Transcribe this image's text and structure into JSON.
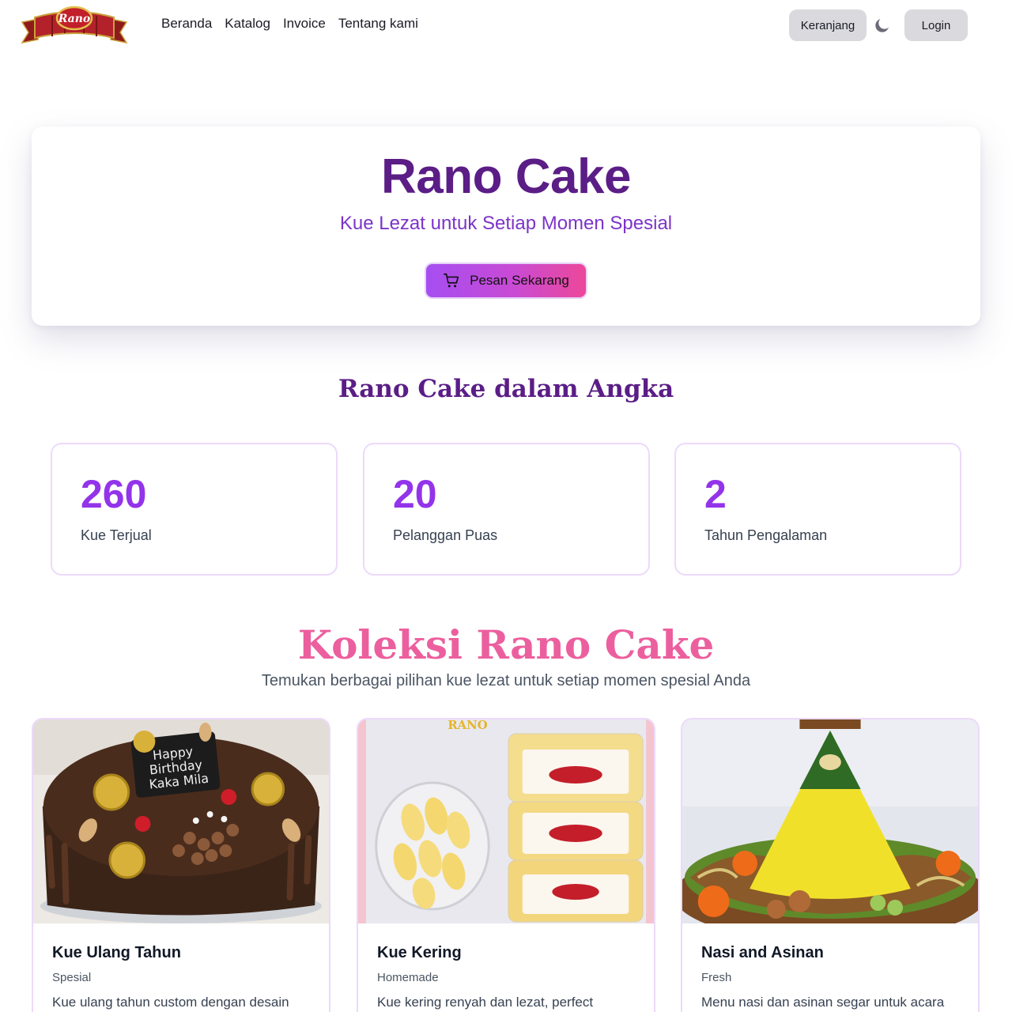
{
  "nav": {
    "logo_text": "Rano",
    "links": [
      "Beranda",
      "Katalog",
      "Invoice",
      "Tentang kami"
    ],
    "cart_label": "Keranjang",
    "login_label": "Login",
    "theme_icon": "moon-icon"
  },
  "hero": {
    "title": "Rano Cake",
    "subtitle": "Kue Lezat untuk Setiap Momen Spesial",
    "cta_label": "Pesan Sekarang",
    "cta_icon": "cart-icon"
  },
  "stats": {
    "title": "Rano Cake dalam Angka",
    "items": [
      {
        "value": "260",
        "label": "Kue Terjual"
      },
      {
        "value": "20",
        "label": "Pelanggan Puas"
      },
      {
        "value": "2",
        "label": "Tahun Pengalaman"
      }
    ]
  },
  "collection": {
    "title": "Koleksi Rano Cake",
    "subtitle": "Temukan berbagai pilihan kue lezat untuk setiap momen spesial Anda",
    "products": [
      {
        "name": "Kue Ulang Tahun",
        "tag": "Spesial",
        "desc": "Kue ulang tahun custom dengan desain",
        "image_text": "Happy Birthday Kaka Mila"
      },
      {
        "name": "Kue Kering",
        "tag": "Homemade",
        "desc": "Kue kering renyah dan lezat, perfect",
        "image_text": "RANO"
      },
      {
        "name": "Nasi and Asinan",
        "tag": "Fresh",
        "desc": "Menu nasi dan asinan segar untuk acara",
        "image_text": ""
      }
    ]
  },
  "colors": {
    "primary_purple": "#5b1d86",
    "accent_purple": "#9333ea",
    "pink": "#ec4899",
    "card_border": "#ecd9fb"
  }
}
